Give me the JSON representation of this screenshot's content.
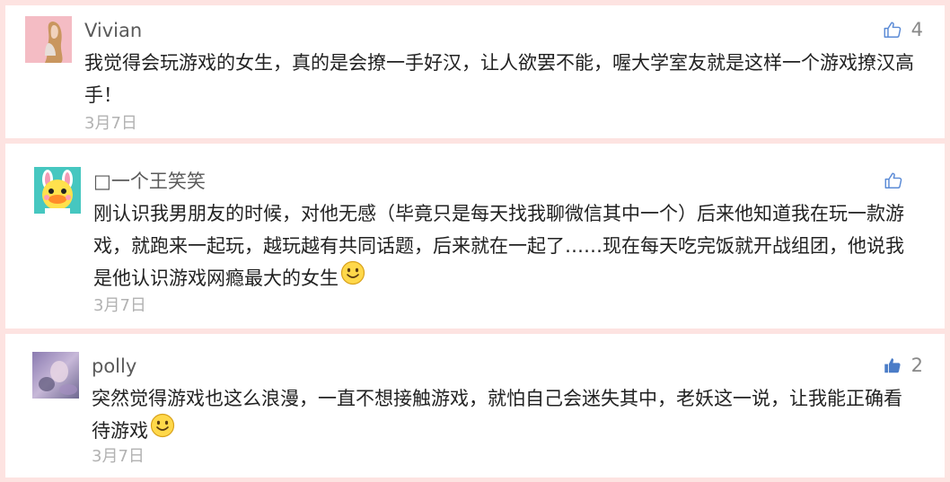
{
  "colors": {
    "page_background": "#fde3e1",
    "card_background": "#ffffff",
    "like_outline": "#5b8bd6",
    "like_filled": "#4a7cc7",
    "username": "#5a5a5a",
    "date": "#b2b2b2"
  },
  "comments": [
    {
      "username": "Vivian",
      "avatar_icon": "woman-with-long-hair-photo",
      "content": "我觉得会玩游戏的女生，真的是会撩一手好汉，让人欲罢不能，喔大学室友就是这样一个游戏撩汉高手！",
      "date": "3月7日",
      "like_icon": "thumbs-up-outline-icon",
      "like_count": "4"
    },
    {
      "username": "□一个王笑笑",
      "avatar_icon": "cartoon-duck-bunny",
      "content": "刚认识我男朋友的时候，对他无感（毕竟只是每天找我聊微信其中一个）后来他知道我在玩一款游戏，就跑来一起玩，越玩越有共同话题，后来就在一起了……现在每天吃完饭就开战组团，他说我是他认识游戏网瘾最大的女生",
      "emoji_icon": "smiley-face-icon",
      "date": "3月7日",
      "like_icon": "thumbs-up-outline-icon",
      "like_count": ""
    },
    {
      "username": "polly",
      "avatar_icon": "blurred-purple-photo",
      "content": "突然觉得游戏也这么浪漫，一直不想接触游戏，就怕自己会迷失其中，老妖这一说，让我能正确看待游戏",
      "emoji_icon": "smiley-face-icon",
      "date": "3月7日",
      "like_icon": "thumbs-up-filled-icon",
      "like_count": "2"
    }
  ]
}
